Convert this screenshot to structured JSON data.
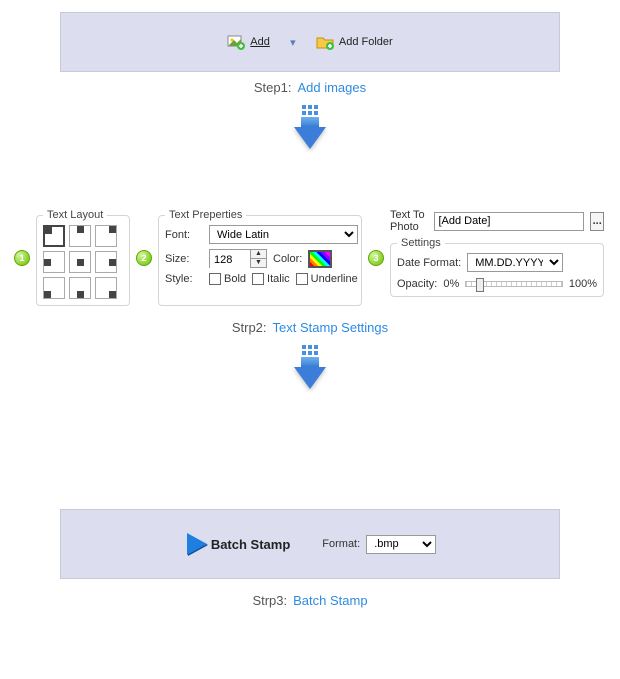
{
  "step1": {
    "add_label": "Add",
    "add_folder_label": "Add Folder",
    "caption_key": "Step1:",
    "caption_val": "Add images"
  },
  "step2": {
    "text_layout_legend": "Text Layout",
    "text_properties_legend": "Text Preperties",
    "font_label": "Font:",
    "font_value": "Wide Latin",
    "size_label": "Size:",
    "size_value": "128",
    "color_label": "Color:",
    "style_label": "Style:",
    "bold_label": "Bold",
    "italic_label": "Italic",
    "underline_label": "Underline",
    "text_to_photo_label": "Text To Photo",
    "text_to_photo_value": "[Add Date]",
    "settings_legend": "Settings",
    "date_format_label": "Date Format:",
    "date_format_value": "MM.DD.YYYY",
    "opacity_label": "Opacity:",
    "opacity_low": "0%",
    "opacity_high": "100%",
    "caption_key": "Strp2:",
    "caption_val": "Text Stamp Settings"
  },
  "step3": {
    "batch_label": "Batch Stamp",
    "format_label": "Format:",
    "format_value": ".bmp",
    "caption_key": "Strp3:",
    "caption_val": "Batch Stamp"
  },
  "badges": [
    "1",
    "2",
    "3"
  ]
}
